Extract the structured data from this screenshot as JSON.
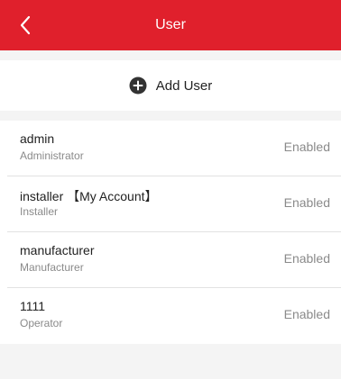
{
  "header": {
    "title": "User",
    "back_icon": "chevron-left-icon",
    "background_color": "#e0202c"
  },
  "add_user": {
    "label": "Add User",
    "icon": "plus-circle-icon"
  },
  "users": [
    {
      "name": "admin",
      "role": "Administrator",
      "status": "Enabled"
    },
    {
      "name": "installer 【My Account】",
      "role": "Installer",
      "status": "Enabled"
    },
    {
      "name": "manufacturer",
      "role": "Manufacturer",
      "status": "Enabled"
    },
    {
      "name": "1111",
      "role": "Operator",
      "status": "Enabled"
    }
  ]
}
